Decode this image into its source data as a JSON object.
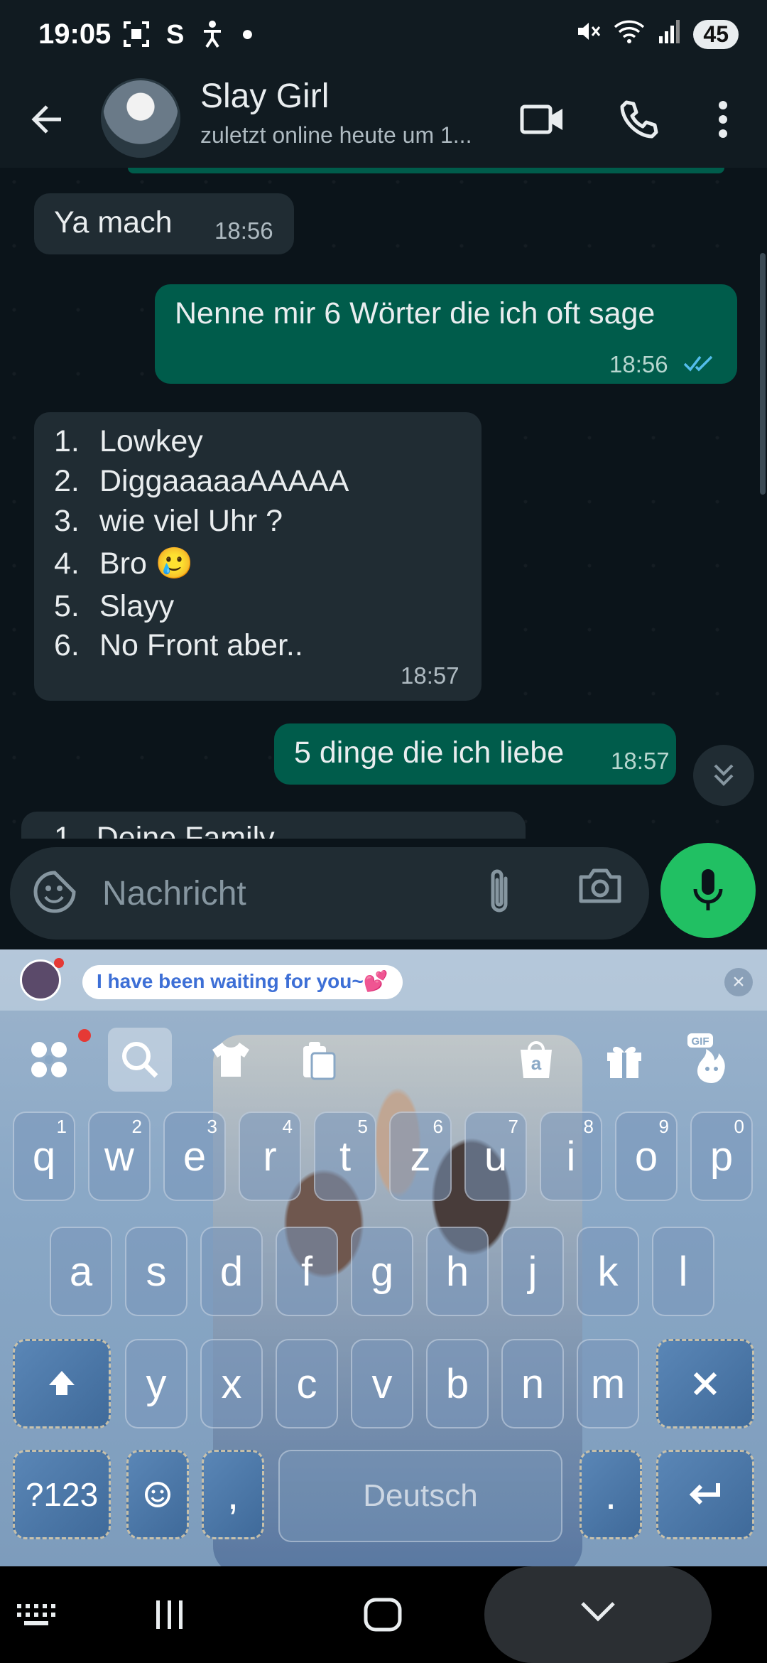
{
  "status_bar": {
    "time": "19:05",
    "left_icons": [
      "screenshot-icon",
      "shazam-icon",
      "accessibility-icon",
      "dot-icon"
    ],
    "battery": "45"
  },
  "header": {
    "contact_name": "Slay Girl",
    "contact_status": "zuletzt online heute um 1..."
  },
  "messages": [
    {
      "direction": "incoming",
      "text": "Ya mach",
      "time": "18:56"
    },
    {
      "direction": "outgoing",
      "text": "Nenne mir 6 Wörter die ich oft sage",
      "time": "18:56"
    },
    {
      "direction": "incoming",
      "list": [
        {
          "num": "1.",
          "text": "Lowkey"
        },
        {
          "num": "2.",
          "text": "DiggaaaaaAAAAA"
        },
        {
          "num": "3.",
          "text": "wie viel Uhr ?"
        },
        {
          "num": "4.",
          "text": "Bro 🥲"
        },
        {
          "num": "5.",
          "text": "Slayy"
        },
        {
          "num": "6.",
          "text": "No Front aber.."
        }
      ],
      "time": "18:57"
    },
    {
      "direction": "outgoing",
      "text": "5 dinge die ich liebe",
      "time": "18:57"
    },
    {
      "direction": "incoming",
      "partial_text": "1.  Deine Family"
    }
  ],
  "input": {
    "placeholder": "Nachricht"
  },
  "keyboard": {
    "promo_text": "I have been waiting for you~💕",
    "row1": [
      {
        "key": "q",
        "hint": "1"
      },
      {
        "key": "w",
        "hint": "2"
      },
      {
        "key": "e",
        "hint": "3"
      },
      {
        "key": "r",
        "hint": "4"
      },
      {
        "key": "t",
        "hint": "5"
      },
      {
        "key": "z",
        "hint": "6"
      },
      {
        "key": "u",
        "hint": "7"
      },
      {
        "key": "i",
        "hint": "8"
      },
      {
        "key": "o",
        "hint": "9"
      },
      {
        "key": "p",
        "hint": "0"
      }
    ],
    "row2": [
      "a",
      "s",
      "d",
      "f",
      "g",
      "h",
      "j",
      "k",
      "l"
    ],
    "row3": [
      "y",
      "x",
      "c",
      "v",
      "b",
      "n",
      "m"
    ],
    "symbols_label": "?123",
    "comma_label": ",",
    "period_label": ".",
    "space_label": "Deutsch",
    "toolbar_icons": [
      "apps-icon",
      "search-icon",
      "theme-shirt-icon",
      "clipboard-icon",
      "amazon-icon",
      "gift-icon",
      "gif-icon"
    ]
  },
  "colors": {
    "outgoing_bubble": "#005c4b",
    "incoming_bubble": "#202c33",
    "mic_button": "#21c063",
    "read_ticks": "#53bdeb"
  }
}
